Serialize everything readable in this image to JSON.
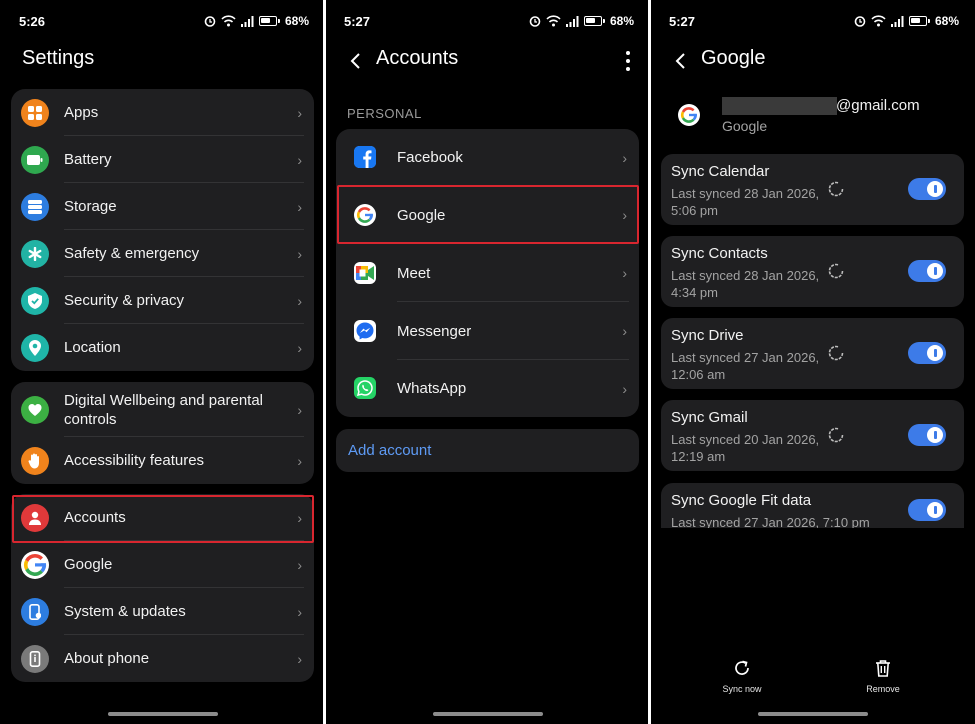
{
  "colors": {
    "accent": "#3d7be8",
    "highlight": "#d8262f",
    "link": "#5e9bf5",
    "card": "#1f1f21"
  },
  "panel1": {
    "status": {
      "time": "5:26",
      "battery": "68%"
    },
    "title": "Settings",
    "group1": [
      {
        "label": "Apps",
        "icon": "apps-icon",
        "color": "#f0831c"
      },
      {
        "label": "Battery",
        "icon": "battery-icon",
        "color": "#2fa84f"
      },
      {
        "label": "Storage",
        "icon": "storage-icon",
        "color": "#2d7de0"
      },
      {
        "label": "Safety & emergency",
        "icon": "asterisk-icon",
        "color": "#22b3a4"
      },
      {
        "label": "Security & privacy",
        "icon": "shield-icon",
        "color": "#1fb5a8"
      },
      {
        "label": "Location",
        "icon": "location-pin-icon",
        "color": "#1fb5a8"
      }
    ],
    "group2": [
      {
        "label": "Digital Wellbeing and parental controls",
        "icon": "wellbeing-icon",
        "color": "#3cb043"
      },
      {
        "label": "Accessibility features",
        "icon": "hand-icon",
        "color": "#f0831c"
      }
    ],
    "group3": [
      {
        "label": "Accounts",
        "icon": "person-icon",
        "color": "#e0393a"
      },
      {
        "label": "Google",
        "icon": "google-icon",
        "color": "#ffffff"
      },
      {
        "label": "System & updates",
        "icon": "phone-update-icon",
        "color": "#2d7de0"
      },
      {
        "label": "About phone",
        "icon": "phone-info-icon",
        "color": "#7a7a7a"
      }
    ]
  },
  "panel2": {
    "status": {
      "time": "5:27",
      "battery": "68%"
    },
    "title": "Accounts",
    "section": "PERSONAL",
    "accounts": [
      {
        "label": "Facebook",
        "icon": "facebook-icon"
      },
      {
        "label": "Google",
        "icon": "google-icon"
      },
      {
        "label": "Meet",
        "icon": "meet-icon"
      },
      {
        "label": "Messenger",
        "icon": "messenger-icon"
      },
      {
        "label": "WhatsApp",
        "icon": "whatsapp-icon"
      }
    ],
    "add_account": "Add account"
  },
  "panel3": {
    "status": {
      "time": "5:27",
      "battery": "68%"
    },
    "title": "Google",
    "account": {
      "email_suffix": "@gmail.com",
      "provider": "Google"
    },
    "syncs": [
      {
        "title": "Sync Calendar",
        "sub": "Last synced 28 Jan 2026, 5:06 pm",
        "enabled": true
      },
      {
        "title": "Sync Contacts",
        "sub": "Last synced 28 Jan 2026, 4:34 pm",
        "enabled": true
      },
      {
        "title": "Sync Drive",
        "sub": "Last synced 27 Jan 2026, 12:06 am",
        "enabled": true
      },
      {
        "title": "Sync Gmail",
        "sub": "Last synced 20 Jan 2026, 12:19 am",
        "enabled": true
      },
      {
        "title": "Sync Google Fit data",
        "sub": "Last synced 27 Jan 2026, 7:10 pm",
        "enabled": true
      }
    ],
    "actions": {
      "sync_now": "Sync now",
      "remove": "Remove"
    }
  }
}
